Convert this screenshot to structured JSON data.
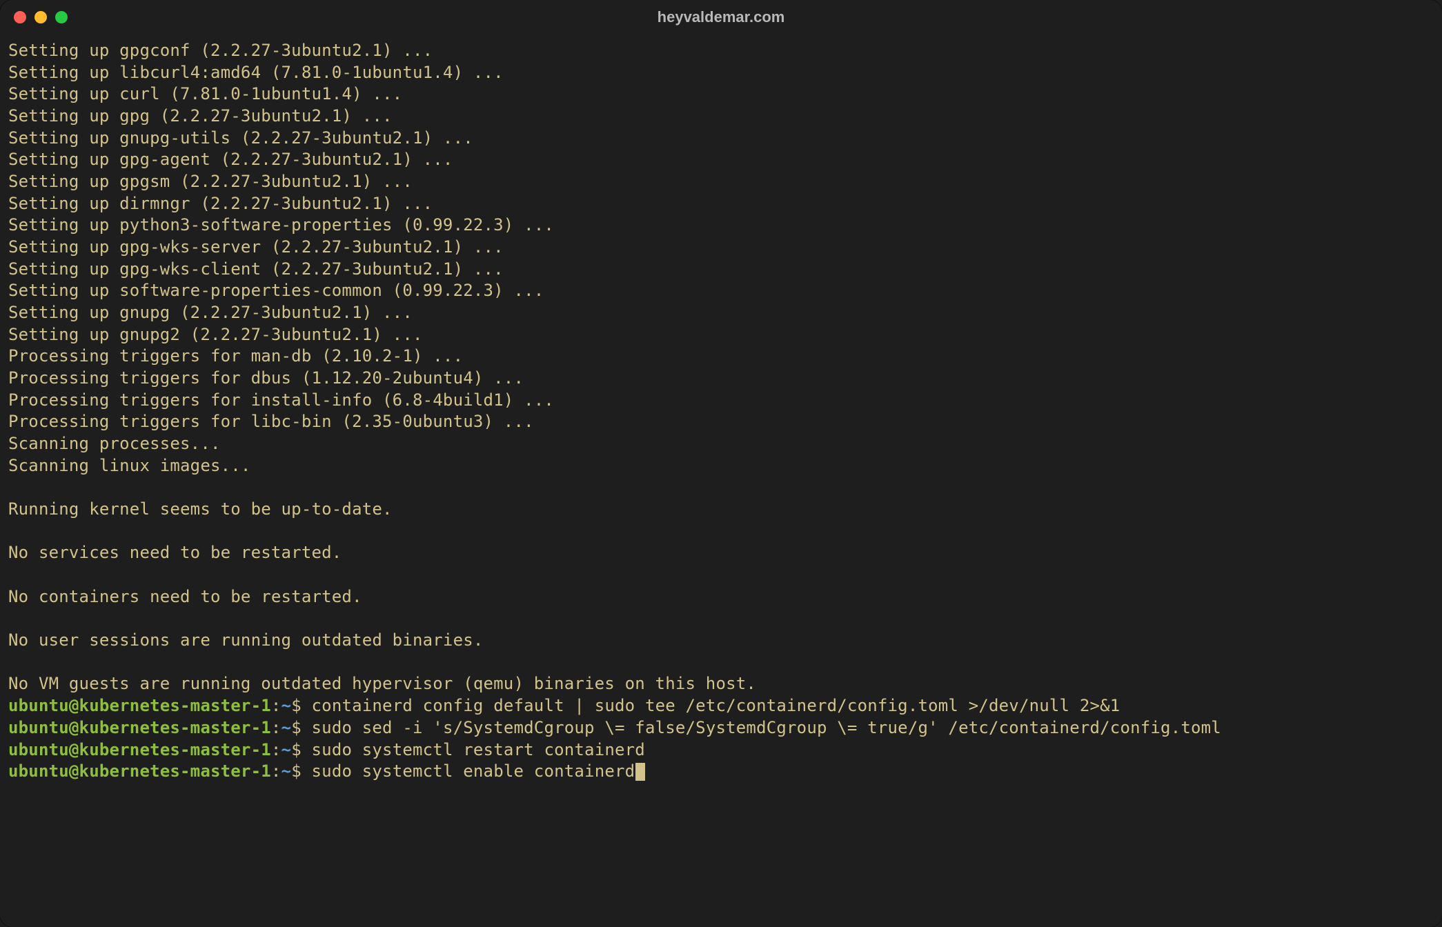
{
  "window": {
    "title": "heyvaldemar.com"
  },
  "colors": {
    "bg": "#1e1e1e",
    "text": "#d2c28c",
    "prompt_user": "#8fbf3f",
    "prompt_path": "#5c9bd4",
    "traffic_red": "#ff5f57",
    "traffic_yellow": "#febc2e",
    "traffic_green": "#28c840"
  },
  "output_lines": [
    "Setting up gpgconf (2.2.27-3ubuntu2.1) ...",
    "Setting up libcurl4:amd64 (7.81.0-1ubuntu1.4) ...",
    "Setting up curl (7.81.0-1ubuntu1.4) ...",
    "Setting up gpg (2.2.27-3ubuntu2.1) ...",
    "Setting up gnupg-utils (2.2.27-3ubuntu2.1) ...",
    "Setting up gpg-agent (2.2.27-3ubuntu2.1) ...",
    "Setting up gpgsm (2.2.27-3ubuntu2.1) ...",
    "Setting up dirmngr (2.2.27-3ubuntu2.1) ...",
    "Setting up python3-software-properties (0.99.22.3) ...",
    "Setting up gpg-wks-server (2.2.27-3ubuntu2.1) ...",
    "Setting up gpg-wks-client (2.2.27-3ubuntu2.1) ...",
    "Setting up software-properties-common (0.99.22.3) ...",
    "Setting up gnupg (2.2.27-3ubuntu2.1) ...",
    "Setting up gnupg2 (2.2.27-3ubuntu2.1) ...",
    "Processing triggers for man-db (2.10.2-1) ...",
    "Processing triggers for dbus (1.12.20-2ubuntu4) ...",
    "Processing triggers for install-info (6.8-4build1) ...",
    "Processing triggers for libc-bin (2.35-0ubuntu3) ...",
    "Scanning processes...",
    "Scanning linux images...",
    "",
    "Running kernel seems to be up-to-date.",
    "",
    "No services need to be restarted.",
    "",
    "No containers need to be restarted.",
    "",
    "No user sessions are running outdated binaries.",
    "",
    "No VM guests are running outdated hypervisor (qemu) binaries on this host."
  ],
  "prompt": {
    "user_host": "ubuntu@kubernetes-master-1",
    "colon": ":",
    "path": "~",
    "dollar": "$ "
  },
  "commands": [
    "containerd config default | sudo tee /etc/containerd/config.toml >/dev/null 2>&1",
    "sudo sed -i 's/SystemdCgroup \\= false/SystemdCgroup \\= true/g' /etc/containerd/config.toml",
    "sudo systemctl restart containerd",
    "sudo systemctl enable containerd"
  ]
}
